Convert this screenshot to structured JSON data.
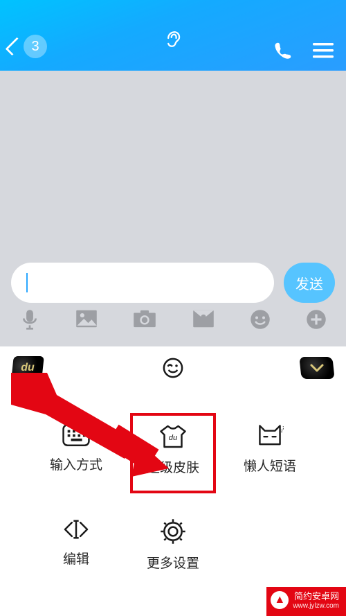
{
  "header": {
    "unread_count": "3"
  },
  "input": {
    "send_label": "发送"
  },
  "kbd_menu": {
    "cells": [
      {
        "label": "输入方式"
      },
      {
        "label": "超级皮肤"
      },
      {
        "label": "懒人短语"
      },
      {
        "label": "编辑"
      },
      {
        "label": "更多设置"
      }
    ]
  },
  "watermark": {
    "line1": "简约安卓网",
    "line2": "www.jylzw.com"
  }
}
